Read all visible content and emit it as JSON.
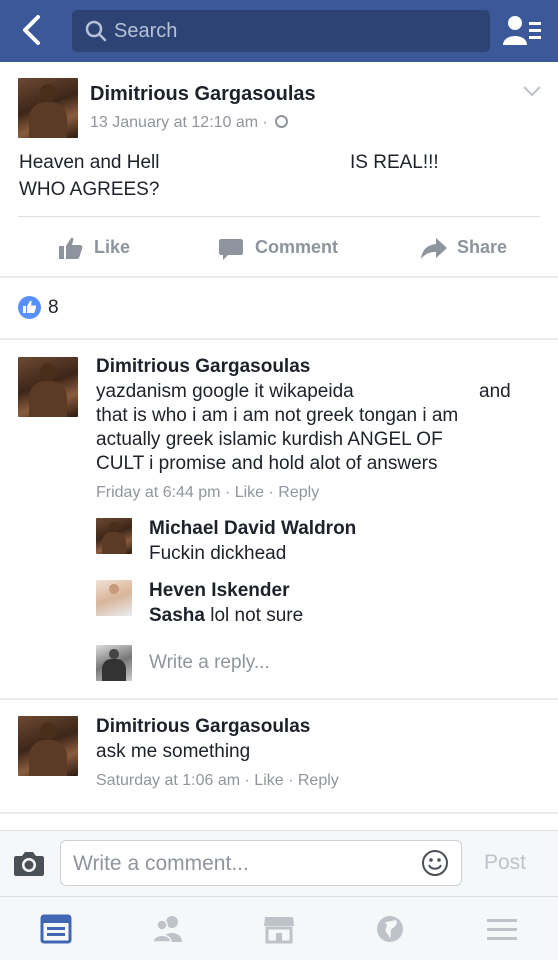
{
  "header": {
    "search_placeholder": "Search"
  },
  "post": {
    "author": "Dimitrious Gargasoulas",
    "timestamp": "13 January at 12:10 am ·",
    "text_line1_part1": "Heaven and Hell",
    "text_line1_part2": "IS REAL!!!",
    "text_line2": "WHO AGREES?",
    "actions": {
      "like": "Like",
      "comment": "Comment",
      "share": "Share"
    },
    "like_count": "8"
  },
  "comments": [
    {
      "author": "Dimitrious Gargasoulas",
      "lines": [
        "yazdanism google it wikapeida",
        "and",
        "that is who i am i am not greek tongan i am",
        "actually greek islamic kurdish ANGEL OF",
        "CULT  i promise and hold alot of answers"
      ],
      "meta": "Friday at 6:44 pm · Like · Reply",
      "replies": [
        {
          "author": "Michael David Waldron",
          "text": "Fuckin dickhead"
        },
        {
          "author": "Heven Iskender",
          "mention": "Sasha",
          "text": " lol not sure"
        }
      ],
      "reply_placeholder": "Write a reply..."
    },
    {
      "author": "Dimitrious Gargasoulas",
      "lines": [
        "ask me something"
      ],
      "meta": "Saturday at 1:06 am · Like · Reply"
    }
  ],
  "composer": {
    "placeholder": "Write a comment...",
    "post_label": "Post"
  },
  "icons": [
    "back-icon",
    "search-icon",
    "friend-requests-icon",
    "chevron-down-icon",
    "globe-icon",
    "like-icon",
    "comment-icon",
    "share-icon",
    "camera-icon",
    "smiley-icon",
    "news-feed-icon",
    "friends-icon",
    "marketplace-icon",
    "notifications-icon",
    "menu-icon"
  ],
  "colors": {
    "brand": "#3b5998",
    "active_tab": "#4267b2",
    "muted": "#90949c"
  }
}
